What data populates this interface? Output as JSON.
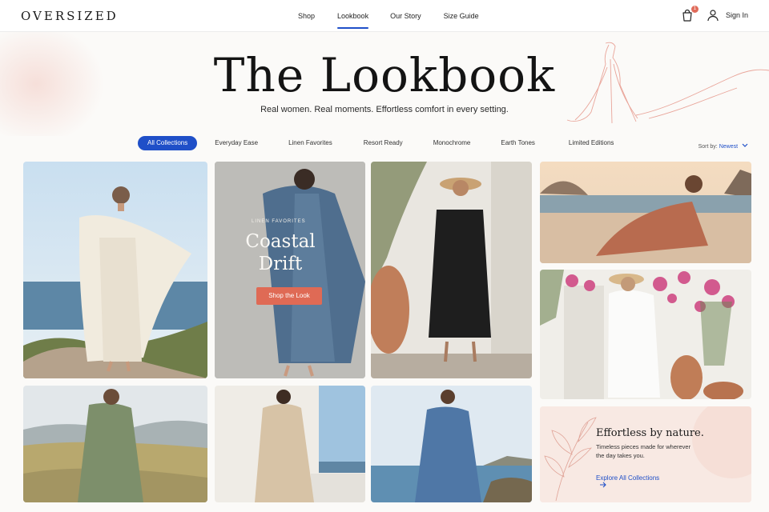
{
  "brand": {
    "logo": "OVERSIZED"
  },
  "nav": {
    "items": [
      "Shop",
      "Lookbook",
      "Our Story",
      "Size Guide"
    ],
    "active": "Lookbook"
  },
  "header_right": {
    "cart_count": "1",
    "signin_label": "Sign In",
    "icons": [
      "shopping-bag-icon",
      "user-icon"
    ]
  },
  "hero": {
    "title": "The Lookbook",
    "subtitle": "Real women. Real moments. Effortless comfort in every setting."
  },
  "filters": {
    "chips": [
      "All Collections",
      "Everyday Ease",
      "Linen Favorites",
      "Resort Ready",
      "Monochrome",
      "Earth Tones",
      "Limited Editions"
    ],
    "active": "All Collections"
  },
  "sort": {
    "label": "Sort by:",
    "value": "Newest"
  },
  "promo": {
    "kicker": "LINEN FAVORITES",
    "title_line1": "Coastal",
    "title_line2": "Drift",
    "button": "Shop the Look"
  },
  "cta": {
    "title": "Effortless by nature.",
    "text": "Timeless pieces made for wherever the day takes you.",
    "link": "Explore All Collections"
  },
  "colors": {
    "accent": "#1f4fc8",
    "promo_button": "#df6a55",
    "badge": "#e06b5a"
  }
}
